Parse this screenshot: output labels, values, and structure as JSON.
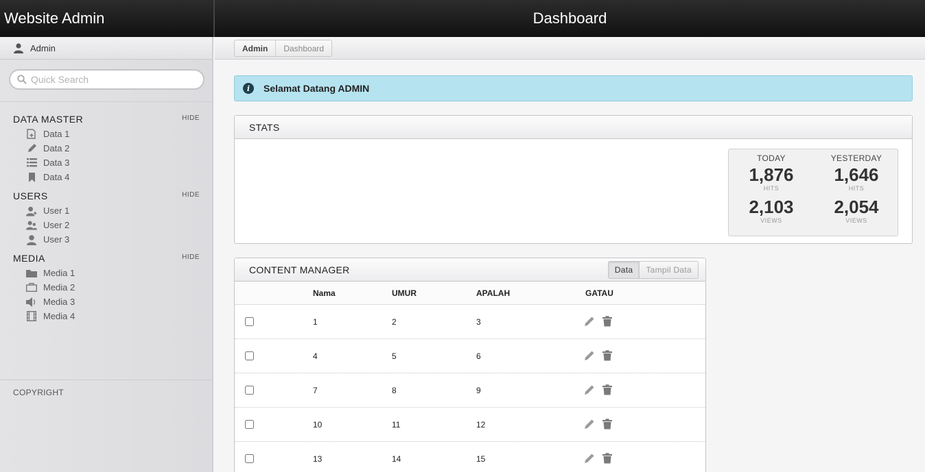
{
  "app": {
    "title": "Website Admin",
    "page_title": "Dashboard"
  },
  "user": {
    "name": "Admin"
  },
  "search": {
    "placeholder": "Quick Search"
  },
  "sidebar": {
    "sections": [
      {
        "title": "DATA MASTER",
        "hide_label": "HIDE",
        "items": [
          {
            "label": "Data 1",
            "icon": "add-document-icon"
          },
          {
            "label": "Data 2",
            "icon": "pencil-icon"
          },
          {
            "label": "Data 3",
            "icon": "list-icon"
          },
          {
            "label": "Data 4",
            "icon": "bookmark-icon"
          }
        ]
      },
      {
        "title": "USERS",
        "hide_label": "HIDE",
        "items": [
          {
            "label": "User 1",
            "icon": "user-add-icon"
          },
          {
            "label": "User 2",
            "icon": "users-icon"
          },
          {
            "label": "User 3",
            "icon": "user-icon"
          }
        ]
      },
      {
        "title": "MEDIA",
        "hide_label": "HIDE",
        "items": [
          {
            "label": "Media 1",
            "icon": "folder-icon"
          },
          {
            "label": "Media 2",
            "icon": "briefcase-icon"
          },
          {
            "label": "Media 3",
            "icon": "speaker-icon"
          },
          {
            "label": "Media 4",
            "icon": "film-icon"
          }
        ]
      }
    ],
    "copyright": "COPYRIGHT"
  },
  "breadcrumb": {
    "first": "Admin",
    "last": "Dashboard"
  },
  "alert": {
    "text": "Selamat Datang ADMIN",
    "icon": "info-icon"
  },
  "stats": {
    "title": "STATS",
    "columns": [
      {
        "heading": "TODAY",
        "hits": "1,876",
        "hits_label": "HITS",
        "views": "2,103",
        "views_label": "VIEWS"
      },
      {
        "heading": "YESTERDAY",
        "hits": "1,646",
        "hits_label": "HITS",
        "views": "2,054",
        "views_label": "VIEWS"
      }
    ]
  },
  "content_manager": {
    "title": "CONTENT MANAGER",
    "tabs": [
      {
        "label": "Data",
        "active": true
      },
      {
        "label": "Tampil Data",
        "active": false
      }
    ],
    "headers": [
      "Nama",
      "UMUR",
      "APALAH",
      "GATAU"
    ],
    "rows": [
      [
        "1",
        "2",
        "3"
      ],
      [
        "4",
        "5",
        "6"
      ],
      [
        "7",
        "8",
        "9"
      ],
      [
        "10",
        "11",
        "12"
      ],
      [
        "13",
        "14",
        "15"
      ]
    ]
  }
}
